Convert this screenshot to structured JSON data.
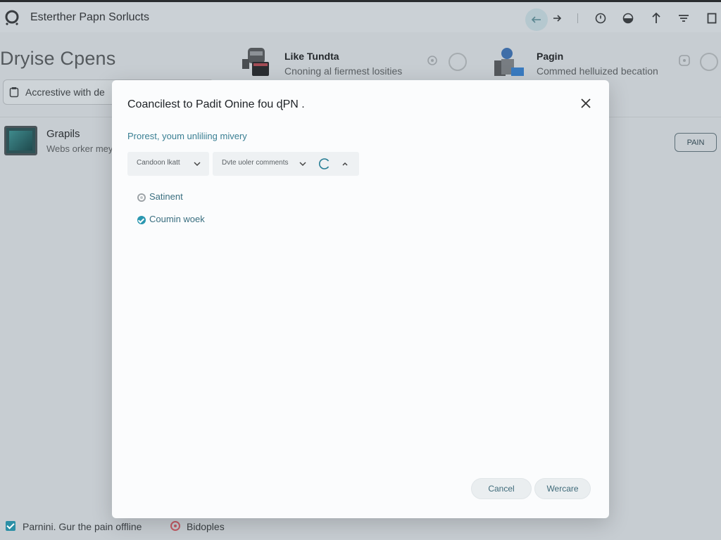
{
  "app": {
    "title": "Esterther Papn Sorlucts"
  },
  "toolbar": {
    "back": "back-icon",
    "forward": "forward-icon",
    "icons": [
      "clock-icon",
      "half-circle-icon",
      "upload-icon",
      "filter-icon",
      "window-icon"
    ]
  },
  "background": {
    "heading": "Dryise Cpens",
    "search_placeholder": "Accrestive with de",
    "cards": [
      {
        "title": "Like Tundta",
        "subtitle": "Cnoning al fiermest losities"
      },
      {
        "title": "Pagin",
        "subtitle": "Commed helluized becation"
      }
    ],
    "item": {
      "title": "Grapils",
      "subtitle": "Webs orker meye"
    },
    "pain_button": "PAIN"
  },
  "bottom": {
    "checkbox_label": "Parnini. Gur the pain offline",
    "checkbox_checked": true,
    "second_label": "Bidoples"
  },
  "modal": {
    "title": "Coancilest to Padit Onine fou ɖPN .",
    "subtitle": "Prorest, youm unliliing mivery",
    "select1": "Candoon lkatt",
    "select2": "Dvte uoler comments",
    "options": [
      {
        "label": "Satinent",
        "selected": false
      },
      {
        "label": "Coumin woek",
        "selected": true
      }
    ],
    "cancel_label": "Cancel",
    "ok_label": "Wercare"
  },
  "colors": {
    "accent": "#2a97b0",
    "overlay": "#c7cdd2",
    "modal_bg": "#fbfcfd"
  }
}
